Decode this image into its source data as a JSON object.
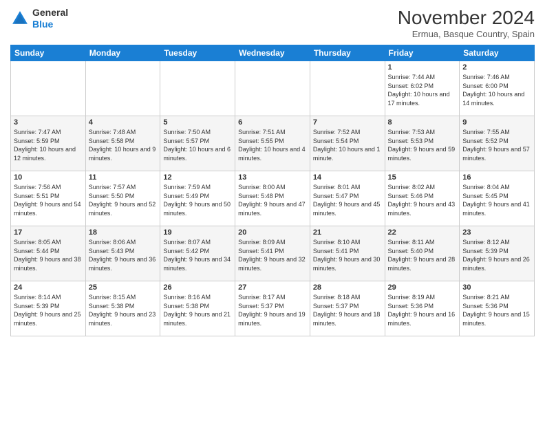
{
  "header": {
    "logo_line1": "General",
    "logo_line2": "Blue",
    "month_title": "November 2024",
    "subtitle": "Ermua, Basque Country, Spain"
  },
  "days_of_week": [
    "Sunday",
    "Monday",
    "Tuesday",
    "Wednesday",
    "Thursday",
    "Friday",
    "Saturday"
  ],
  "weeks": [
    [
      {
        "day": "",
        "info": ""
      },
      {
        "day": "",
        "info": ""
      },
      {
        "day": "",
        "info": ""
      },
      {
        "day": "",
        "info": ""
      },
      {
        "day": "",
        "info": ""
      },
      {
        "day": "1",
        "info": "Sunrise: 7:44 AM\nSunset: 6:02 PM\nDaylight: 10 hours and 17 minutes."
      },
      {
        "day": "2",
        "info": "Sunrise: 7:46 AM\nSunset: 6:00 PM\nDaylight: 10 hours and 14 minutes."
      }
    ],
    [
      {
        "day": "3",
        "info": "Sunrise: 7:47 AM\nSunset: 5:59 PM\nDaylight: 10 hours and 12 minutes."
      },
      {
        "day": "4",
        "info": "Sunrise: 7:48 AM\nSunset: 5:58 PM\nDaylight: 10 hours and 9 minutes."
      },
      {
        "day": "5",
        "info": "Sunrise: 7:50 AM\nSunset: 5:57 PM\nDaylight: 10 hours and 6 minutes."
      },
      {
        "day": "6",
        "info": "Sunrise: 7:51 AM\nSunset: 5:55 PM\nDaylight: 10 hours and 4 minutes."
      },
      {
        "day": "7",
        "info": "Sunrise: 7:52 AM\nSunset: 5:54 PM\nDaylight: 10 hours and 1 minute."
      },
      {
        "day": "8",
        "info": "Sunrise: 7:53 AM\nSunset: 5:53 PM\nDaylight: 9 hours and 59 minutes."
      },
      {
        "day": "9",
        "info": "Sunrise: 7:55 AM\nSunset: 5:52 PM\nDaylight: 9 hours and 57 minutes."
      }
    ],
    [
      {
        "day": "10",
        "info": "Sunrise: 7:56 AM\nSunset: 5:51 PM\nDaylight: 9 hours and 54 minutes."
      },
      {
        "day": "11",
        "info": "Sunrise: 7:57 AM\nSunset: 5:50 PM\nDaylight: 9 hours and 52 minutes."
      },
      {
        "day": "12",
        "info": "Sunrise: 7:59 AM\nSunset: 5:49 PM\nDaylight: 9 hours and 50 minutes."
      },
      {
        "day": "13",
        "info": "Sunrise: 8:00 AM\nSunset: 5:48 PM\nDaylight: 9 hours and 47 minutes."
      },
      {
        "day": "14",
        "info": "Sunrise: 8:01 AM\nSunset: 5:47 PM\nDaylight: 9 hours and 45 minutes."
      },
      {
        "day": "15",
        "info": "Sunrise: 8:02 AM\nSunset: 5:46 PM\nDaylight: 9 hours and 43 minutes."
      },
      {
        "day": "16",
        "info": "Sunrise: 8:04 AM\nSunset: 5:45 PM\nDaylight: 9 hours and 41 minutes."
      }
    ],
    [
      {
        "day": "17",
        "info": "Sunrise: 8:05 AM\nSunset: 5:44 PM\nDaylight: 9 hours and 38 minutes."
      },
      {
        "day": "18",
        "info": "Sunrise: 8:06 AM\nSunset: 5:43 PM\nDaylight: 9 hours and 36 minutes."
      },
      {
        "day": "19",
        "info": "Sunrise: 8:07 AM\nSunset: 5:42 PM\nDaylight: 9 hours and 34 minutes."
      },
      {
        "day": "20",
        "info": "Sunrise: 8:09 AM\nSunset: 5:41 PM\nDaylight: 9 hours and 32 minutes."
      },
      {
        "day": "21",
        "info": "Sunrise: 8:10 AM\nSunset: 5:41 PM\nDaylight: 9 hours and 30 minutes."
      },
      {
        "day": "22",
        "info": "Sunrise: 8:11 AM\nSunset: 5:40 PM\nDaylight: 9 hours and 28 minutes."
      },
      {
        "day": "23",
        "info": "Sunrise: 8:12 AM\nSunset: 5:39 PM\nDaylight: 9 hours and 26 minutes."
      }
    ],
    [
      {
        "day": "24",
        "info": "Sunrise: 8:14 AM\nSunset: 5:39 PM\nDaylight: 9 hours and 25 minutes."
      },
      {
        "day": "25",
        "info": "Sunrise: 8:15 AM\nSunset: 5:38 PM\nDaylight: 9 hours and 23 minutes."
      },
      {
        "day": "26",
        "info": "Sunrise: 8:16 AM\nSunset: 5:38 PM\nDaylight: 9 hours and 21 minutes."
      },
      {
        "day": "27",
        "info": "Sunrise: 8:17 AM\nSunset: 5:37 PM\nDaylight: 9 hours and 19 minutes."
      },
      {
        "day": "28",
        "info": "Sunrise: 8:18 AM\nSunset: 5:37 PM\nDaylight: 9 hours and 18 minutes."
      },
      {
        "day": "29",
        "info": "Sunrise: 8:19 AM\nSunset: 5:36 PM\nDaylight: 9 hours and 16 minutes."
      },
      {
        "day": "30",
        "info": "Sunrise: 8:21 AM\nSunset: 5:36 PM\nDaylight: 9 hours and 15 minutes."
      }
    ]
  ]
}
